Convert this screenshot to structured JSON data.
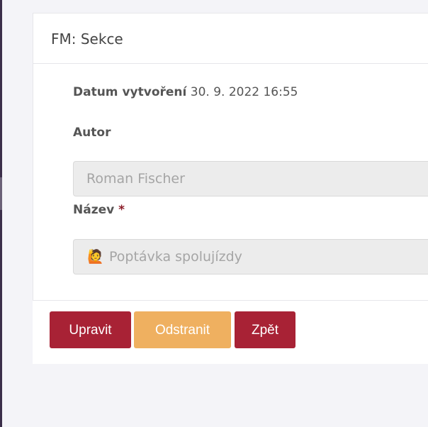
{
  "card": {
    "title": "FM: Sekce"
  },
  "meta": {
    "created_label": "Datum vytvoření",
    "created_value": "30. 9. 2022 16:55"
  },
  "fields": {
    "author": {
      "label": "Autor",
      "value": "Roman Fischer"
    },
    "name": {
      "label": "Název",
      "required_mark": "*",
      "emoji": "🙋",
      "value": "Poptávka spolujízdy"
    }
  },
  "actions": {
    "edit": "Upravit",
    "delete": "Odstranit",
    "back": "Zpět"
  },
  "colors": {
    "primary": "#a82235",
    "warning": "#efb060",
    "field_bg": "#ececec",
    "required": "#8b1b27"
  }
}
